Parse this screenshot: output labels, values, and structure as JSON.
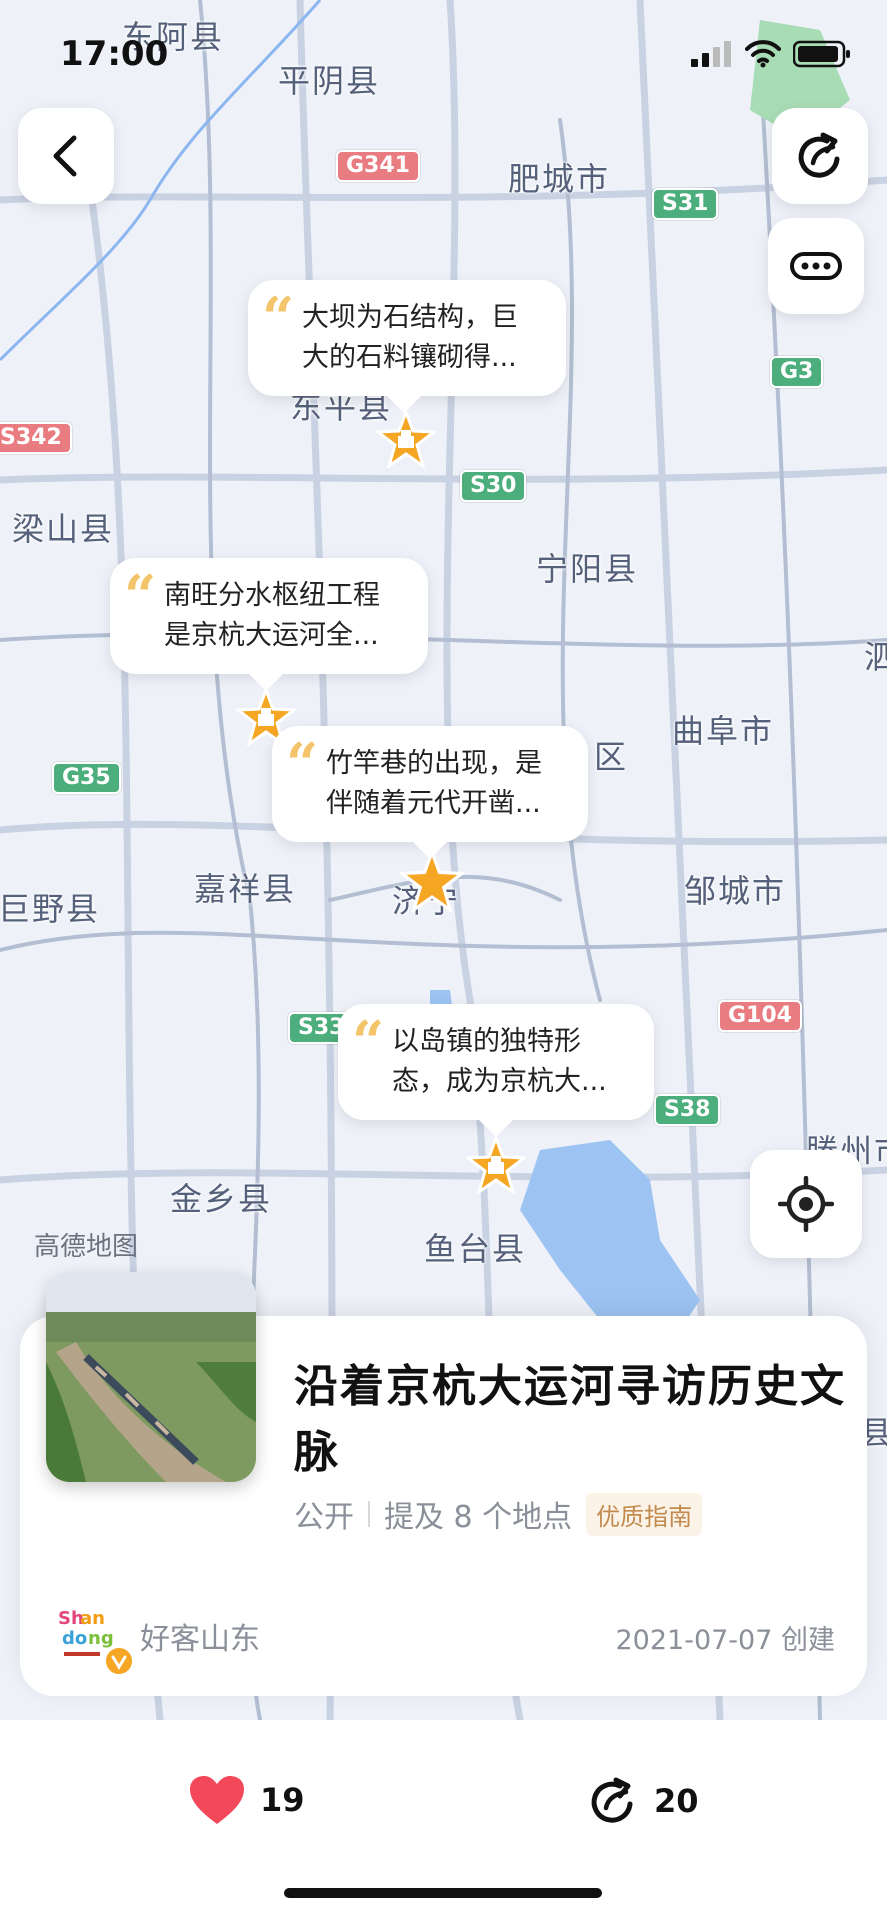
{
  "status_bar": {
    "time": "17:00"
  },
  "map": {
    "places": [
      "东阿县",
      "平阴县",
      "肥城市",
      "东平县",
      "梁山县",
      "宁阳县",
      "曲阜市",
      "嘉祥县",
      "巨野县",
      "邹城市",
      "金乡县",
      "鱼台县",
      "济宁",
      "区",
      "泗",
      "滕州市",
      "县"
    ],
    "road_shields": [
      {
        "label": "G341",
        "color": "red"
      },
      {
        "label": "S31",
        "color": "green"
      },
      {
        "label": "G3",
        "color": "green"
      },
      {
        "label": "S342",
        "color": "red"
      },
      {
        "label": "S30",
        "color": "green"
      },
      {
        "label": "G35",
        "color": "green"
      },
      {
        "label": "S33",
        "color": "green"
      },
      {
        "label": "G104",
        "color": "red"
      },
      {
        "label": "S38",
        "color": "green"
      }
    ],
    "watermark": "高德地图"
  },
  "bubbles": [
    {
      "line1": "大坝为石结构，巨",
      "line2": "大的石料镶砌得..."
    },
    {
      "line1": "南旺分水枢纽工程",
      "line2": "是京杭大运河全..."
    },
    {
      "line1": "竹竿巷的出现，是",
      "line2": "伴随着元代开凿..."
    },
    {
      "line1": "以岛镇的独特形",
      "line2": "态，成为京杭大..."
    }
  ],
  "card": {
    "title": "沿着京杭大运河寻访历史文脉",
    "visibility": "公开",
    "places_mentioned": "提及 8 个地点",
    "tag": "优质指南",
    "author": "好客山东",
    "created": "2021-07-07 创建"
  },
  "actions": {
    "likes": "19",
    "shares": "20"
  },
  "colors": {
    "accent": "#f5a623",
    "like": "#f2485a"
  }
}
